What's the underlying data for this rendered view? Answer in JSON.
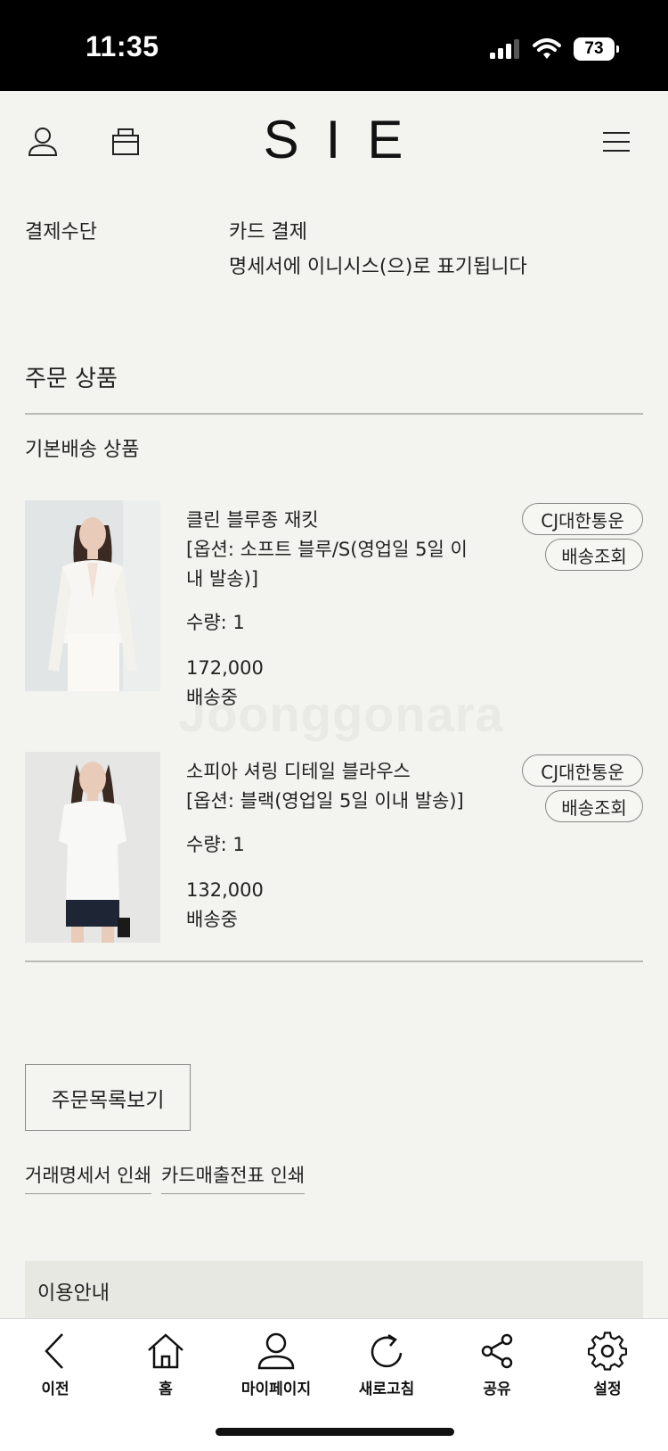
{
  "status_bar": {
    "time": "11:35",
    "battery": "73"
  },
  "header": {
    "logo": "SIE",
    "account_icon": "user-icon",
    "cart_icon": "bag-icon",
    "menu_icon": "hamburger-icon"
  },
  "payment": {
    "label": "결제수단",
    "value": "카드 결제",
    "note": "명세서에 이니시스(으)로 표기됩니다"
  },
  "order_products": {
    "title": "주문 상품",
    "subtitle": "기본배송 상품",
    "items": [
      {
        "name": "클린 블루종 재킷",
        "option_line1": "[옵션: 소프트 블루/S(영업일 5일 이",
        "option_line2": "내 발송)]",
        "quantity": "수량: 1",
        "price": "172,000",
        "status": "배송중",
        "courier": "CJ대한통운",
        "track_label": "배송조회"
      },
      {
        "name": "소피아 셔링 디테일 블라우스",
        "option_line1": "[옵션: 블랙(영업일 5일 이내 발송)]",
        "quantity": "수량: 1",
        "price": "132,000",
        "status": "배송중",
        "courier": "CJ대한통운",
        "track_label": "배송조회"
      }
    ]
  },
  "actions": {
    "order_list_button": "주문목록보기",
    "statement_print": "거래명세서 인쇄",
    "card_slip_print": "카드매출전표 인쇄"
  },
  "info": {
    "label": "이용안내"
  },
  "bottom_nav": {
    "items": [
      {
        "label": "이전",
        "icon": "back-icon"
      },
      {
        "label": "홈",
        "icon": "home-icon"
      },
      {
        "label": "마이페이지",
        "icon": "user-icon"
      },
      {
        "label": "새로고침",
        "icon": "refresh-icon"
      },
      {
        "label": "공유",
        "icon": "share-icon"
      },
      {
        "label": "설정",
        "icon": "gear-icon"
      }
    ]
  },
  "watermark": "Joonggonara"
}
